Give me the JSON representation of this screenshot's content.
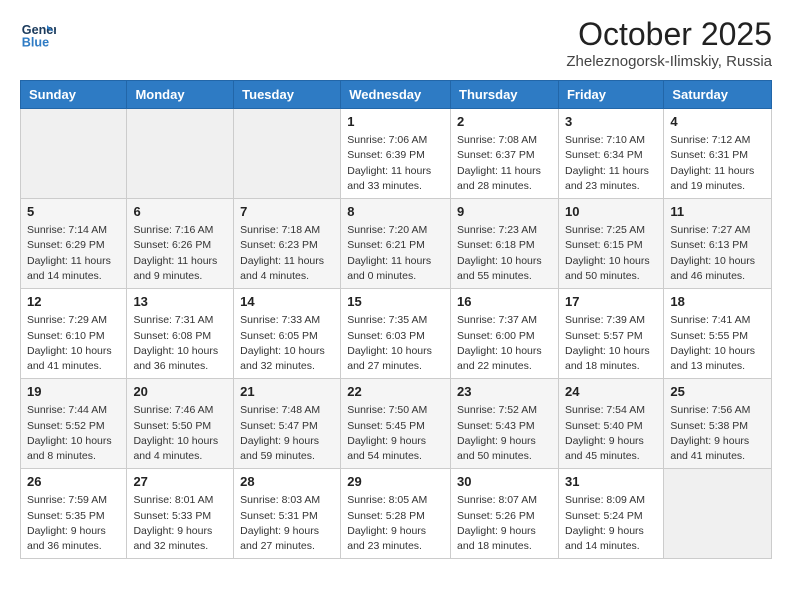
{
  "header": {
    "logo_line1": "General",
    "logo_line2": "Blue",
    "month": "October 2025",
    "location": "Zheleznogorsk-Ilimskiy, Russia"
  },
  "weekdays": [
    "Sunday",
    "Monday",
    "Tuesday",
    "Wednesday",
    "Thursday",
    "Friday",
    "Saturday"
  ],
  "weeks": [
    [
      {
        "day": "",
        "info": ""
      },
      {
        "day": "",
        "info": ""
      },
      {
        "day": "",
        "info": ""
      },
      {
        "day": "1",
        "info": "Sunrise: 7:06 AM\nSunset: 6:39 PM\nDaylight: 11 hours\nand 33 minutes."
      },
      {
        "day": "2",
        "info": "Sunrise: 7:08 AM\nSunset: 6:37 PM\nDaylight: 11 hours\nand 28 minutes."
      },
      {
        "day": "3",
        "info": "Sunrise: 7:10 AM\nSunset: 6:34 PM\nDaylight: 11 hours\nand 23 minutes."
      },
      {
        "day": "4",
        "info": "Sunrise: 7:12 AM\nSunset: 6:31 PM\nDaylight: 11 hours\nand 19 minutes."
      }
    ],
    [
      {
        "day": "5",
        "info": "Sunrise: 7:14 AM\nSunset: 6:29 PM\nDaylight: 11 hours\nand 14 minutes."
      },
      {
        "day": "6",
        "info": "Sunrise: 7:16 AM\nSunset: 6:26 PM\nDaylight: 11 hours\nand 9 minutes."
      },
      {
        "day": "7",
        "info": "Sunrise: 7:18 AM\nSunset: 6:23 PM\nDaylight: 11 hours\nand 4 minutes."
      },
      {
        "day": "8",
        "info": "Sunrise: 7:20 AM\nSunset: 6:21 PM\nDaylight: 11 hours\nand 0 minutes."
      },
      {
        "day": "9",
        "info": "Sunrise: 7:23 AM\nSunset: 6:18 PM\nDaylight: 10 hours\nand 55 minutes."
      },
      {
        "day": "10",
        "info": "Sunrise: 7:25 AM\nSunset: 6:15 PM\nDaylight: 10 hours\nand 50 minutes."
      },
      {
        "day": "11",
        "info": "Sunrise: 7:27 AM\nSunset: 6:13 PM\nDaylight: 10 hours\nand 46 minutes."
      }
    ],
    [
      {
        "day": "12",
        "info": "Sunrise: 7:29 AM\nSunset: 6:10 PM\nDaylight: 10 hours\nand 41 minutes."
      },
      {
        "day": "13",
        "info": "Sunrise: 7:31 AM\nSunset: 6:08 PM\nDaylight: 10 hours\nand 36 minutes."
      },
      {
        "day": "14",
        "info": "Sunrise: 7:33 AM\nSunset: 6:05 PM\nDaylight: 10 hours\nand 32 minutes."
      },
      {
        "day": "15",
        "info": "Sunrise: 7:35 AM\nSunset: 6:03 PM\nDaylight: 10 hours\nand 27 minutes."
      },
      {
        "day": "16",
        "info": "Sunrise: 7:37 AM\nSunset: 6:00 PM\nDaylight: 10 hours\nand 22 minutes."
      },
      {
        "day": "17",
        "info": "Sunrise: 7:39 AM\nSunset: 5:57 PM\nDaylight: 10 hours\nand 18 minutes."
      },
      {
        "day": "18",
        "info": "Sunrise: 7:41 AM\nSunset: 5:55 PM\nDaylight: 10 hours\nand 13 minutes."
      }
    ],
    [
      {
        "day": "19",
        "info": "Sunrise: 7:44 AM\nSunset: 5:52 PM\nDaylight: 10 hours\nand 8 minutes."
      },
      {
        "day": "20",
        "info": "Sunrise: 7:46 AM\nSunset: 5:50 PM\nDaylight: 10 hours\nand 4 minutes."
      },
      {
        "day": "21",
        "info": "Sunrise: 7:48 AM\nSunset: 5:47 PM\nDaylight: 9 hours\nand 59 minutes."
      },
      {
        "day": "22",
        "info": "Sunrise: 7:50 AM\nSunset: 5:45 PM\nDaylight: 9 hours\nand 54 minutes."
      },
      {
        "day": "23",
        "info": "Sunrise: 7:52 AM\nSunset: 5:43 PM\nDaylight: 9 hours\nand 50 minutes."
      },
      {
        "day": "24",
        "info": "Sunrise: 7:54 AM\nSunset: 5:40 PM\nDaylight: 9 hours\nand 45 minutes."
      },
      {
        "day": "25",
        "info": "Sunrise: 7:56 AM\nSunset: 5:38 PM\nDaylight: 9 hours\nand 41 minutes."
      }
    ],
    [
      {
        "day": "26",
        "info": "Sunrise: 7:59 AM\nSunset: 5:35 PM\nDaylight: 9 hours\nand 36 minutes."
      },
      {
        "day": "27",
        "info": "Sunrise: 8:01 AM\nSunset: 5:33 PM\nDaylight: 9 hours\nand 32 minutes."
      },
      {
        "day": "28",
        "info": "Sunrise: 8:03 AM\nSunset: 5:31 PM\nDaylight: 9 hours\nand 27 minutes."
      },
      {
        "day": "29",
        "info": "Sunrise: 8:05 AM\nSunset: 5:28 PM\nDaylight: 9 hours\nand 23 minutes."
      },
      {
        "day": "30",
        "info": "Sunrise: 8:07 AM\nSunset: 5:26 PM\nDaylight: 9 hours\nand 18 minutes."
      },
      {
        "day": "31",
        "info": "Sunrise: 8:09 AM\nSunset: 5:24 PM\nDaylight: 9 hours\nand 14 minutes."
      },
      {
        "day": "",
        "info": ""
      }
    ]
  ]
}
